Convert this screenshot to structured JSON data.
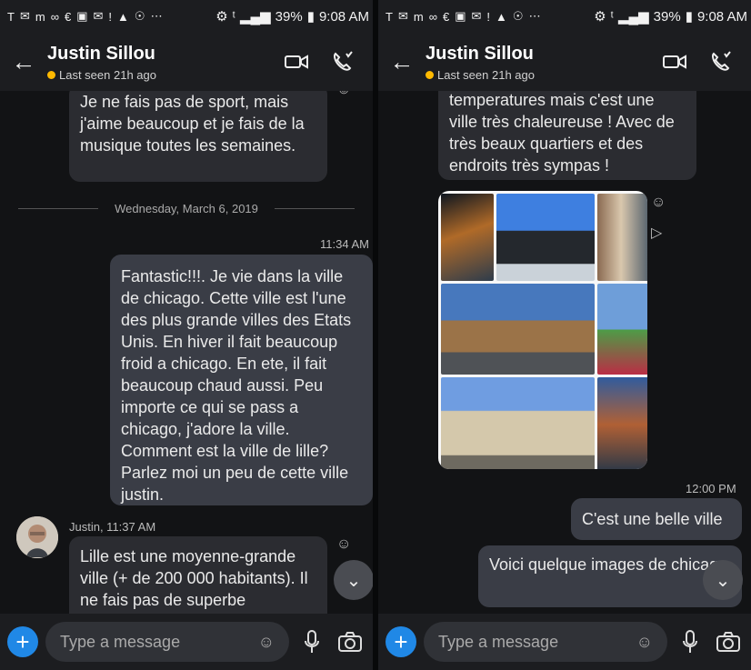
{
  "status": {
    "icons": [
      "T",
      "✉",
      "m",
      "∞",
      "€",
      "▣",
      "✉",
      "!",
      "▲",
      "☉",
      "⋯",
      "⚙",
      "ᵗ"
    ],
    "signal": "▂▄▆",
    "battery": "39%",
    "time": "9:08 AM"
  },
  "header": {
    "back": "←",
    "name": "Justin Sillou",
    "presence": "Last seen 21h ago",
    "accent": "#ffb900"
  },
  "left": {
    "bubble1": "Je ne fais pas de sport, mais j'aime beaucoup et je fais de la musique toutes les semaines.",
    "date": "Wednesday, March 6, 2019",
    "time1": "11:34 AM",
    "bubble2": "Fantastic!!!. Je vie dans la ville de chicago. Cette ville est l'une des plus grande villes des Etats Unis. En hiver il fait beaucoup froid a chicago. En ete, il fait beaucoup chaud aussi. Peu importe ce qui se pass a chicago, j'adore la ville. Comment est la ville de lille? Parlez moi un peu de cette ville justin.",
    "sender": "Justin, 11:37 AM",
    "bubble3": "Lille est une moyenne-grande ville (+ de 200 000 habitants). Il ne fais pas de superbe"
  },
  "right": {
    "bubble1": "temperatures mais c'est une ville très chaleureuse ! Avec de très beaux quartiers et des endroits très sympas !",
    "time1": "12:00 PM",
    "bubble2": "C'est une belle ville",
    "bubble3": "Voici quelque images de chicago"
  },
  "composer": {
    "placeholder": "Type a message",
    "plus": "+"
  },
  "colors": {
    "accent_blue": "#2088e6",
    "bubble": "#2b2c31",
    "sent_bubble": "#3a3d46"
  }
}
